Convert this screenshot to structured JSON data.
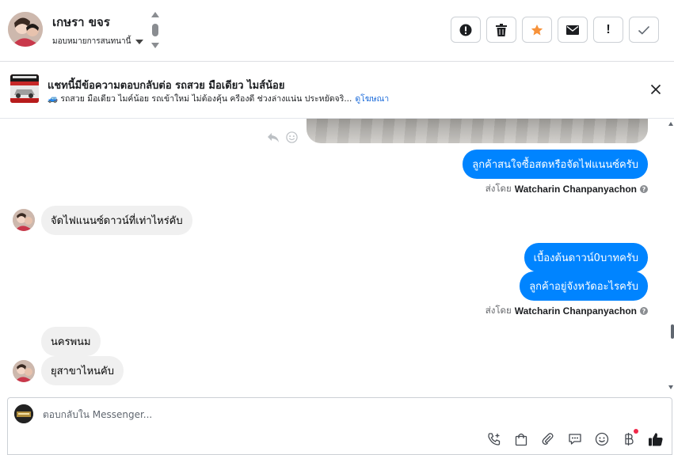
{
  "header": {
    "contact_name": "เกษรา ขจร",
    "assign_label": "มอบหมายการสนทนานี้",
    "actions": [
      {
        "name": "spam-button",
        "icon": "alert-circle-icon"
      },
      {
        "name": "delete-button",
        "icon": "trash-icon"
      },
      {
        "name": "star-button",
        "icon": "star-icon"
      },
      {
        "name": "mark-unread-button",
        "icon": "envelope-icon"
      },
      {
        "name": "follow-up-button",
        "icon": "exclamation-icon",
        "label": "!"
      },
      {
        "name": "mark-done-button",
        "icon": "check-icon"
      }
    ]
  },
  "ad": {
    "title": "แชทนี้มีข้อความตอบกลับต่อ รถสวย มือเดียว ไมส์น้อย",
    "subtitle": "🚙 รถสวย มือเดียว ไมค์น้อย รถเข้าใหม่ ไม่ต้องคุ้น ครีองดี ช่วงล่างแน่น ประหยัดจริ...",
    "link": "ดูโฆษณา"
  },
  "messages": {
    "out1": "ลูกค้าสนใจซื้อสดหรือจัดไฟแนนซ์ครับ",
    "sent_by_1_prefix": "ส่งโดย",
    "sent_by_1_name": "Watcharin Chanpanyachon",
    "in1": "จัดไฟแนนซ์ดาวน์ที่เท่าไหร่คับ",
    "out2": "เบื้องต้นดาวน์0บาทครับ",
    "out3": "ลูกค้าอยู่จังหวัดอะไรครับ",
    "sent_by_2_prefix": "ส่งโดย",
    "sent_by_2_name": "Watcharin Chanpanyachon",
    "in2": "นครพนม",
    "in3": "ยุสาขาไหนคับ"
  },
  "composer": {
    "placeholder": "ตอบกลับใน Messenger..."
  },
  "colors": {
    "accent": "#0084ff",
    "star": "#f7923a",
    "link": "#216fdb",
    "notification": "#f02849"
  }
}
